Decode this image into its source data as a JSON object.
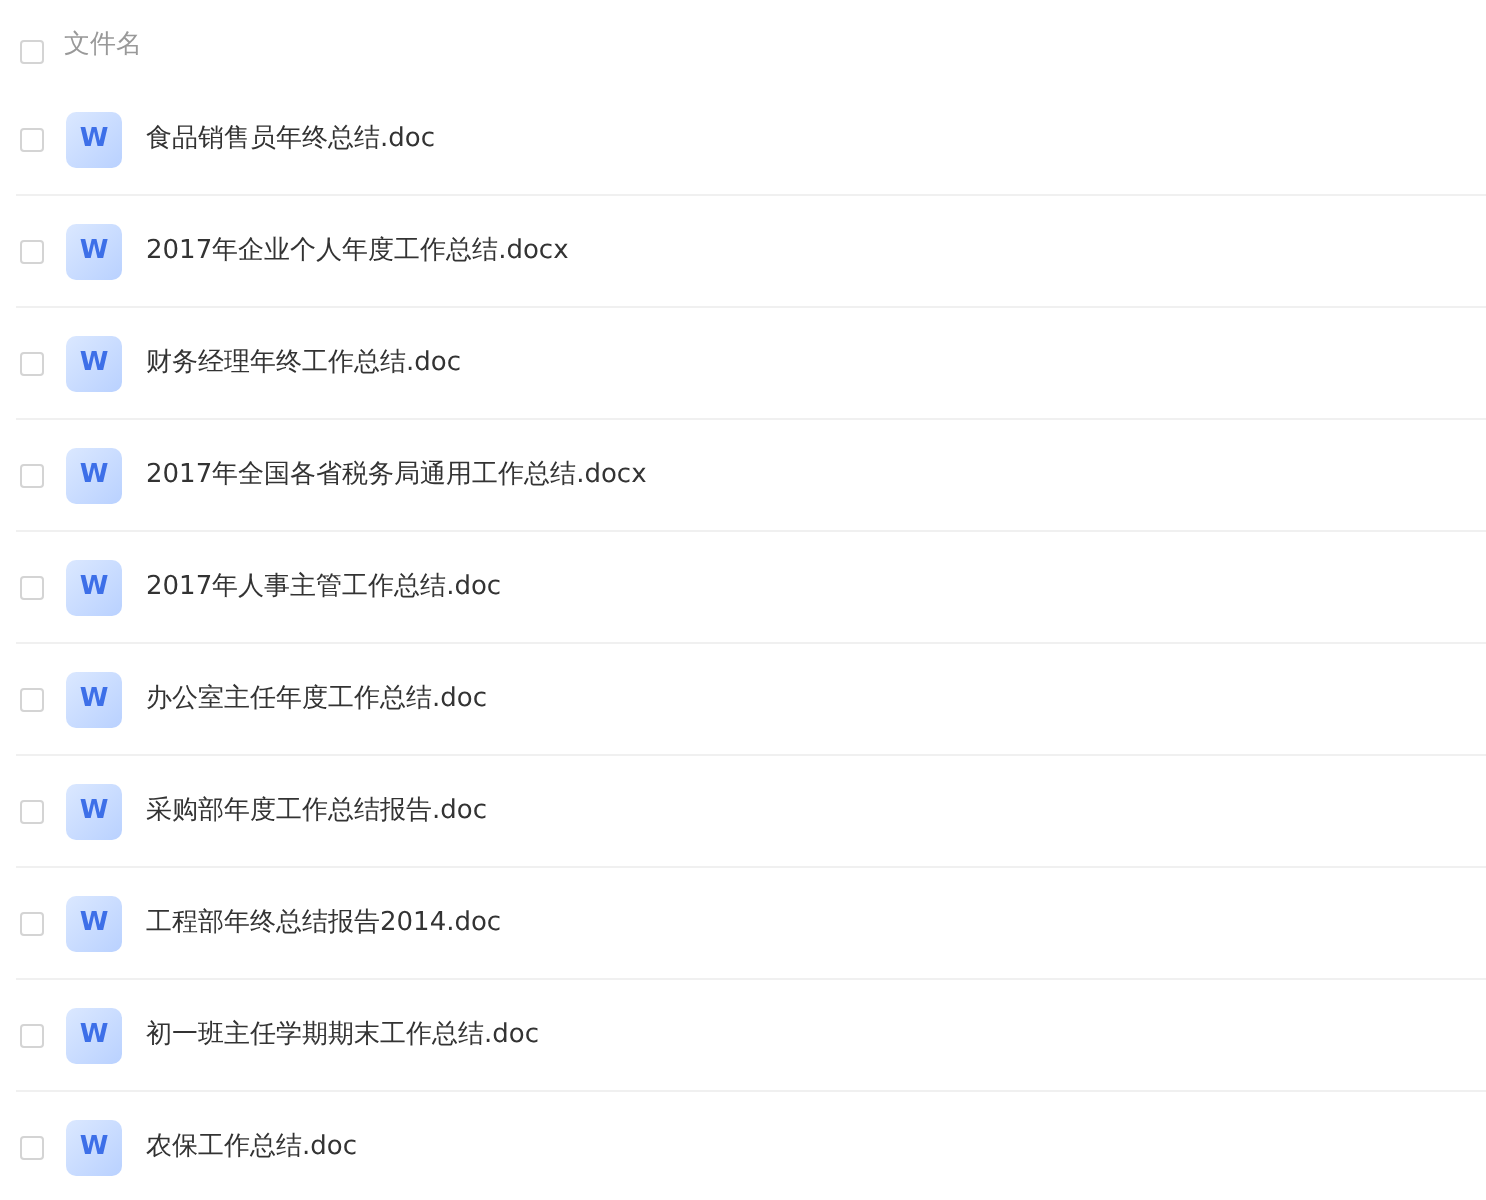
{
  "header": {
    "label": "文件名",
    "checked": false
  },
  "files": [
    {
      "name": "食品销售员年终总结.doc",
      "icon": "W",
      "checked": false
    },
    {
      "name": "2017年企业个人年度工作总结.docx",
      "icon": "W",
      "checked": false
    },
    {
      "name": "财务经理年终工作总结.doc",
      "icon": "W",
      "checked": false
    },
    {
      "name": "2017年全国各省税务局通用工作总结.docx",
      "icon": "W",
      "checked": false
    },
    {
      "name": "2017年人事主管工作总结.doc",
      "icon": "W",
      "checked": false
    },
    {
      "name": "办公室主任年度工作总结.doc",
      "icon": "W",
      "checked": false
    },
    {
      "name": "采购部年度工作总结报告.doc",
      "icon": "W",
      "checked": false
    },
    {
      "name": "工程部年终总结报告2014.doc",
      "icon": "W",
      "checked": false
    },
    {
      "name": "初一班主任学期期末工作总结.doc",
      "icon": "W",
      "checked": false
    },
    {
      "name": "农保工作总结.doc",
      "icon": "W",
      "checked": false
    }
  ]
}
